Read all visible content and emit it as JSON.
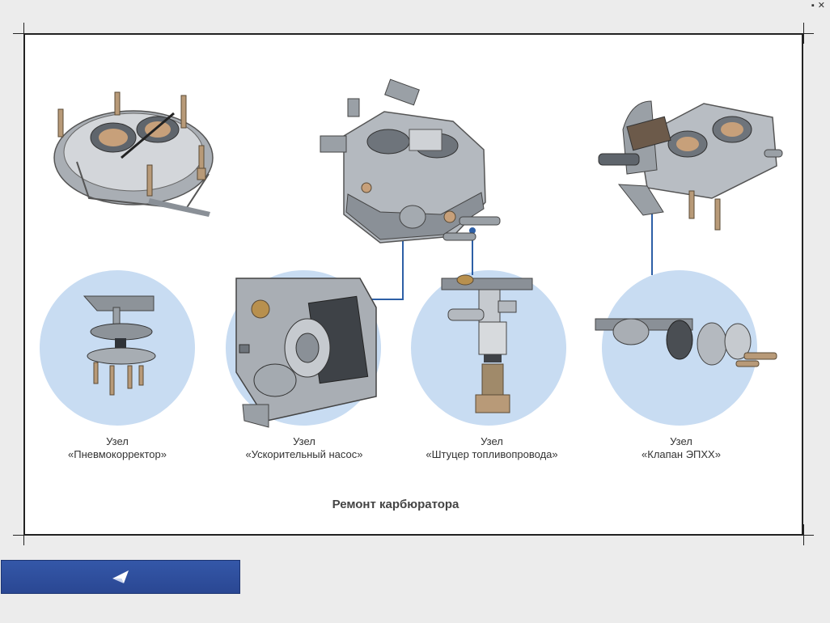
{
  "window": {
    "minimize_glyph": "▪",
    "close_glyph": "✕"
  },
  "callouts": [
    {
      "line1": "Узел",
      "line2": "«Пневмокорректор»"
    },
    {
      "line1": "Узел",
      "line2": "«Ускорительный насос»"
    },
    {
      "line1": "Узел",
      "line2": "«Штуцер топливопровода»"
    },
    {
      "line1": "Узел",
      "line2": "«Клапан ЭПХХ»"
    }
  ],
  "caption": "Ремонт карбюратора",
  "colors": {
    "circle": "#c8dcf2",
    "leader_line": "#2d5fa6",
    "button": "#2f4f9e",
    "metal": "#8f959c"
  },
  "navigation": {
    "back_icon": "arrow-left-icon"
  }
}
